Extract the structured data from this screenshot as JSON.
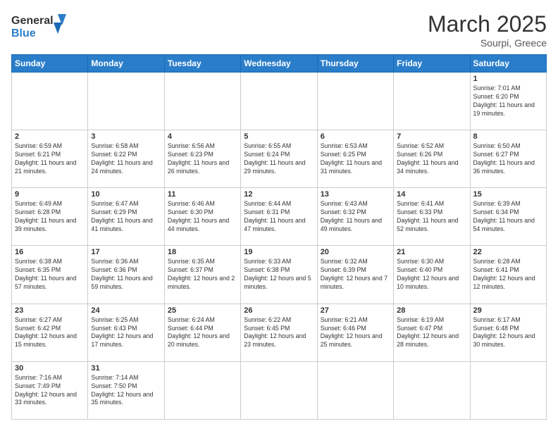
{
  "header": {
    "logo_general": "General",
    "logo_blue": "Blue",
    "title": "March 2025",
    "subtitle": "Sourpi, Greece"
  },
  "weekdays": [
    "Sunday",
    "Monday",
    "Tuesday",
    "Wednesday",
    "Thursday",
    "Friday",
    "Saturday"
  ],
  "weeks": [
    [
      {
        "day": "",
        "info": ""
      },
      {
        "day": "",
        "info": ""
      },
      {
        "day": "",
        "info": ""
      },
      {
        "day": "",
        "info": ""
      },
      {
        "day": "",
        "info": ""
      },
      {
        "day": "",
        "info": ""
      },
      {
        "day": "1",
        "info": "Sunrise: 7:01 AM\nSunset: 6:20 PM\nDaylight: 11 hours and 19 minutes."
      }
    ],
    [
      {
        "day": "2",
        "info": "Sunrise: 6:59 AM\nSunset: 6:21 PM\nDaylight: 11 hours and 21 minutes."
      },
      {
        "day": "3",
        "info": "Sunrise: 6:58 AM\nSunset: 6:22 PM\nDaylight: 11 hours and 24 minutes."
      },
      {
        "day": "4",
        "info": "Sunrise: 6:56 AM\nSunset: 6:23 PM\nDaylight: 11 hours and 26 minutes."
      },
      {
        "day": "5",
        "info": "Sunrise: 6:55 AM\nSunset: 6:24 PM\nDaylight: 11 hours and 29 minutes."
      },
      {
        "day": "6",
        "info": "Sunrise: 6:53 AM\nSunset: 6:25 PM\nDaylight: 11 hours and 31 minutes."
      },
      {
        "day": "7",
        "info": "Sunrise: 6:52 AM\nSunset: 6:26 PM\nDaylight: 11 hours and 34 minutes."
      },
      {
        "day": "8",
        "info": "Sunrise: 6:50 AM\nSunset: 6:27 PM\nDaylight: 11 hours and 36 minutes."
      }
    ],
    [
      {
        "day": "9",
        "info": "Sunrise: 6:49 AM\nSunset: 6:28 PM\nDaylight: 11 hours and 39 minutes."
      },
      {
        "day": "10",
        "info": "Sunrise: 6:47 AM\nSunset: 6:29 PM\nDaylight: 11 hours and 41 minutes."
      },
      {
        "day": "11",
        "info": "Sunrise: 6:46 AM\nSunset: 6:30 PM\nDaylight: 11 hours and 44 minutes."
      },
      {
        "day": "12",
        "info": "Sunrise: 6:44 AM\nSunset: 6:31 PM\nDaylight: 11 hours and 47 minutes."
      },
      {
        "day": "13",
        "info": "Sunrise: 6:43 AM\nSunset: 6:32 PM\nDaylight: 11 hours and 49 minutes."
      },
      {
        "day": "14",
        "info": "Sunrise: 6:41 AM\nSunset: 6:33 PM\nDaylight: 11 hours and 52 minutes."
      },
      {
        "day": "15",
        "info": "Sunrise: 6:39 AM\nSunset: 6:34 PM\nDaylight: 11 hours and 54 minutes."
      }
    ],
    [
      {
        "day": "16",
        "info": "Sunrise: 6:38 AM\nSunset: 6:35 PM\nDaylight: 11 hours and 57 minutes."
      },
      {
        "day": "17",
        "info": "Sunrise: 6:36 AM\nSunset: 6:36 PM\nDaylight: 11 hours and 59 minutes."
      },
      {
        "day": "18",
        "info": "Sunrise: 6:35 AM\nSunset: 6:37 PM\nDaylight: 12 hours and 2 minutes."
      },
      {
        "day": "19",
        "info": "Sunrise: 6:33 AM\nSunset: 6:38 PM\nDaylight: 12 hours and 5 minutes."
      },
      {
        "day": "20",
        "info": "Sunrise: 6:32 AM\nSunset: 6:39 PM\nDaylight: 12 hours and 7 minutes."
      },
      {
        "day": "21",
        "info": "Sunrise: 6:30 AM\nSunset: 6:40 PM\nDaylight: 12 hours and 10 minutes."
      },
      {
        "day": "22",
        "info": "Sunrise: 6:28 AM\nSunset: 6:41 PM\nDaylight: 12 hours and 12 minutes."
      }
    ],
    [
      {
        "day": "23",
        "info": "Sunrise: 6:27 AM\nSunset: 6:42 PM\nDaylight: 12 hours and 15 minutes."
      },
      {
        "day": "24",
        "info": "Sunrise: 6:25 AM\nSunset: 6:43 PM\nDaylight: 12 hours and 17 minutes."
      },
      {
        "day": "25",
        "info": "Sunrise: 6:24 AM\nSunset: 6:44 PM\nDaylight: 12 hours and 20 minutes."
      },
      {
        "day": "26",
        "info": "Sunrise: 6:22 AM\nSunset: 6:45 PM\nDaylight: 12 hours and 23 minutes."
      },
      {
        "day": "27",
        "info": "Sunrise: 6:21 AM\nSunset: 6:46 PM\nDaylight: 12 hours and 25 minutes."
      },
      {
        "day": "28",
        "info": "Sunrise: 6:19 AM\nSunset: 6:47 PM\nDaylight: 12 hours and 28 minutes."
      },
      {
        "day": "29",
        "info": "Sunrise: 6:17 AM\nSunset: 6:48 PM\nDaylight: 12 hours and 30 minutes."
      }
    ],
    [
      {
        "day": "30",
        "info": "Sunrise: 7:16 AM\nSunset: 7:49 PM\nDaylight: 12 hours and 33 minutes."
      },
      {
        "day": "31",
        "info": "Sunrise: 7:14 AM\nSunset: 7:50 PM\nDaylight: 12 hours and 35 minutes."
      },
      {
        "day": "",
        "info": ""
      },
      {
        "day": "",
        "info": ""
      },
      {
        "day": "",
        "info": ""
      },
      {
        "day": "",
        "info": ""
      },
      {
        "day": "",
        "info": ""
      }
    ]
  ]
}
